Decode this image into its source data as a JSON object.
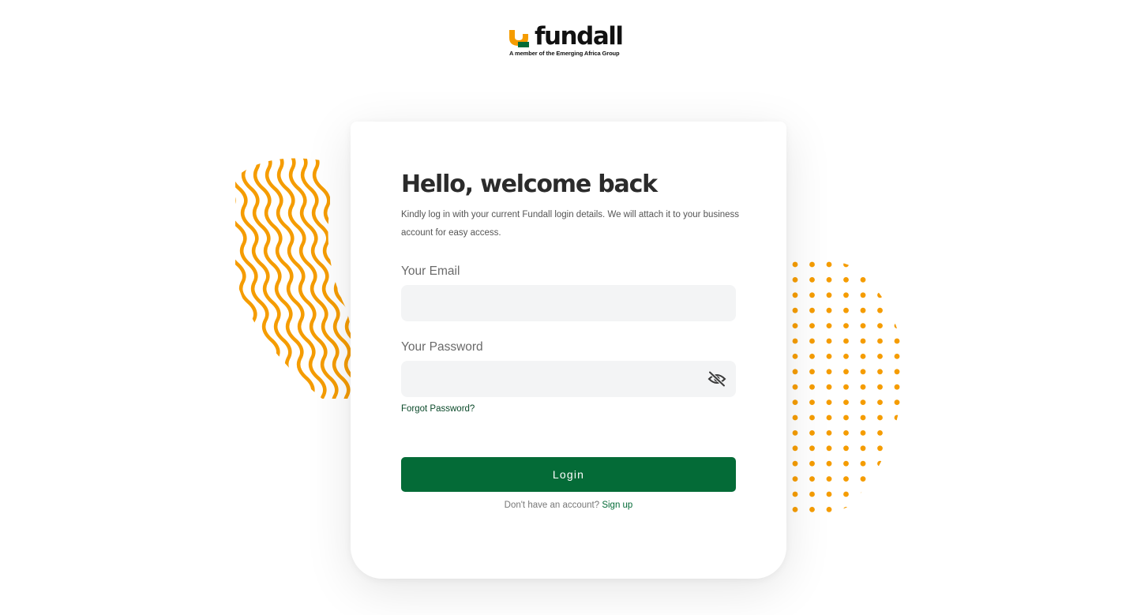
{
  "brand": {
    "name": "fundall",
    "tagline": "A member of the Emerging Africa Group",
    "colors": {
      "primary_green": "#046b37",
      "accent_orange": "#f59c00",
      "text_dark": "#2b2b2b"
    },
    "logo_icon": "fundall-u-mark-icon"
  },
  "login": {
    "title": "Hello, welcome back",
    "subtitle": "Kindly log in with your current Fundall login details. We will attach it to your business account for easy access.",
    "email": {
      "label": "Your Email",
      "value": "",
      "placeholder": ""
    },
    "password": {
      "label": "Your Password",
      "value": "",
      "placeholder": "",
      "toggle_icon": "eye-off-icon"
    },
    "forgot_password": "Forgot Password?",
    "submit_label": "Login",
    "no_account_text": "Don't have an account?",
    "signup_label": "Sign up"
  },
  "decorations": {
    "left": "orange-squiggle-lines",
    "right": "orange-dot-grid"
  }
}
